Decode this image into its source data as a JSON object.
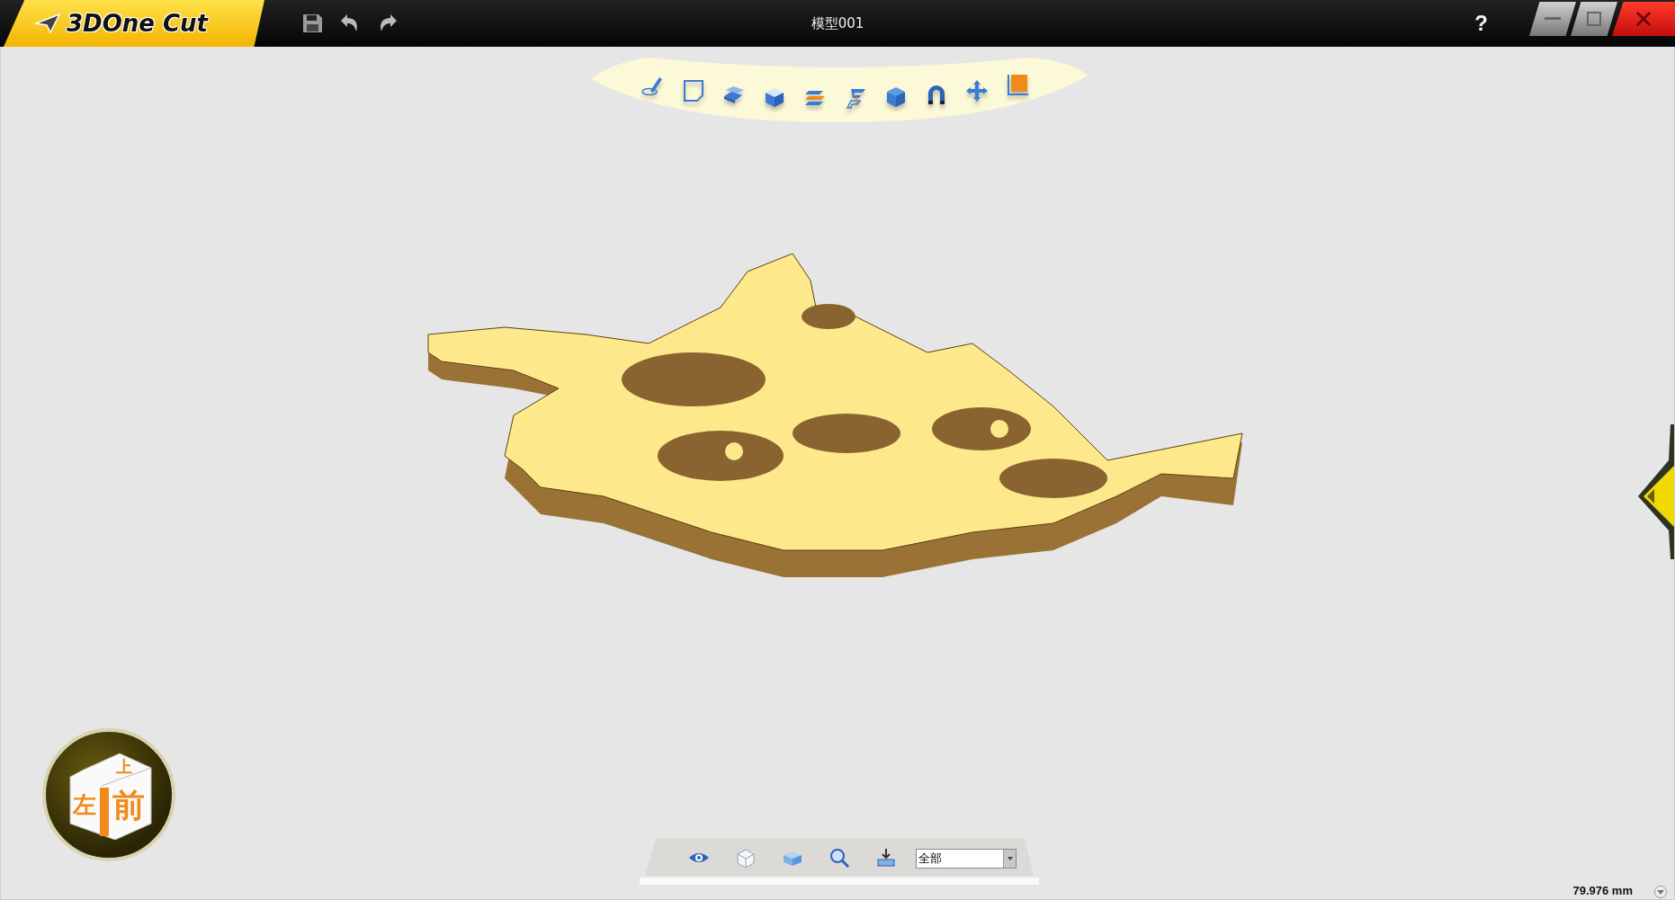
{
  "app": {
    "logo": "3DOne Cut"
  },
  "title_bar": {
    "title": "模型001",
    "help": "?"
  },
  "view_cube": {
    "top": "上",
    "left": "左",
    "front": "前"
  },
  "bottom_toolbar": {
    "filter": {
      "value": "全部"
    }
  },
  "status": {
    "dimension": "79.976 mm"
  }
}
